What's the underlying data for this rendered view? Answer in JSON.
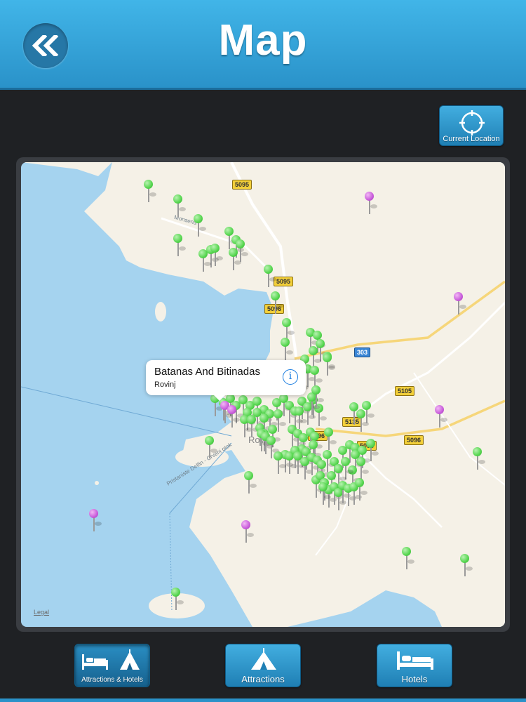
{
  "header": {
    "title": "Map",
    "back_icon": "double-chevron-left-icon"
  },
  "current_location": {
    "label": "Current Location",
    "icon": "crosshair-icon"
  },
  "map": {
    "legal_label": "Legal",
    "callout": {
      "title": "Batanas And Bitinadas",
      "subtitle": "Rovinj",
      "info_icon": "info-icon"
    },
    "road_labels": [
      "5095",
      "5095",
      "5096",
      "303",
      "5105",
      "5135",
      "5096",
      "5096",
      "5096"
    ],
    "place_labels": [
      "Monsena",
      "Pristaniste Delfin - Crveni otok",
      "Rovinj"
    ]
  },
  "tabs": [
    {
      "label": "Attractions & Hotels",
      "icon": "bed-and-tent-icon",
      "active": true
    },
    {
      "label": "Attractions",
      "icon": "tent-icon",
      "active": false
    },
    {
      "label": "Hotels",
      "icon": "bed-icon",
      "active": false
    }
  ],
  "colors": {
    "header_blue": "#2a92c9",
    "pin_green": "#56d64f",
    "pin_purple": "#c95ddb",
    "water": "#a5d3ef",
    "land": "#f5f1e7"
  }
}
